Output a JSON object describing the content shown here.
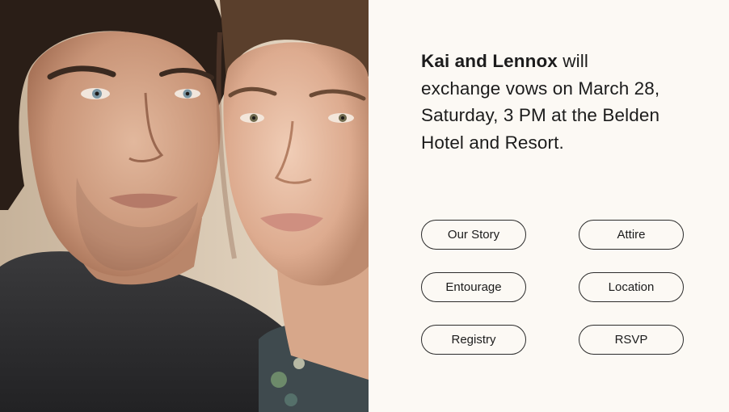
{
  "announcement": {
    "names": "Kai and  Lennox",
    "text": " will exchange vows on March 28, Saturday, 3 PM at the Belden Hotel and Resort."
  },
  "nav": {
    "our_story": "Our Story",
    "attire": "Attire",
    "entourage": "Entourage",
    "location": "Location",
    "registry": "Registry",
    "rsvp": "RSVP"
  },
  "colors": {
    "background": "#fcf9f4",
    "text": "#1c1c1c",
    "button_border": "#2b2b2b"
  }
}
